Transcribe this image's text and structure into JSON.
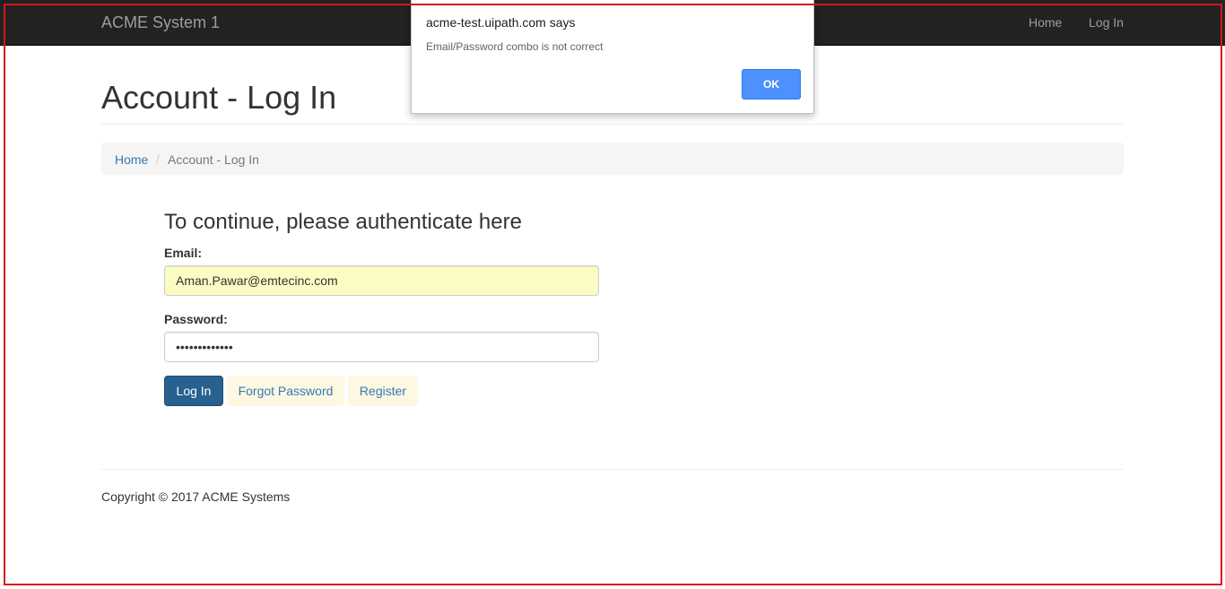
{
  "navbar": {
    "brand": "ACME System 1",
    "links": [
      "Home",
      "Log In"
    ]
  },
  "page": {
    "title": "Account - Log In"
  },
  "breadcrumb": {
    "home": "Home",
    "separator": "/",
    "current": "Account - Log In"
  },
  "form": {
    "heading": "To continue, please authenticate here",
    "email_label": "Email:",
    "email_value": "Aman.Pawar@emtecinc.com",
    "password_label": "Password:",
    "password_value": "•••••••••••••",
    "login_button": "Log In",
    "forgot_button": "Forgot Password",
    "register_button": "Register"
  },
  "footer": {
    "copyright": "Copyright © 2017 ACME Systems"
  },
  "alert": {
    "title": "acme-test.uipath.com says",
    "message": "Email/Password combo is not correct",
    "ok_button": "OK"
  },
  "colors": {
    "navbar_bg": "#222222",
    "primary": "#286090",
    "link": "#337ab7",
    "autofill_bg": "#fbfcc4",
    "dialog_button": "#4d90fe",
    "frame_border": "#d9141b"
  }
}
